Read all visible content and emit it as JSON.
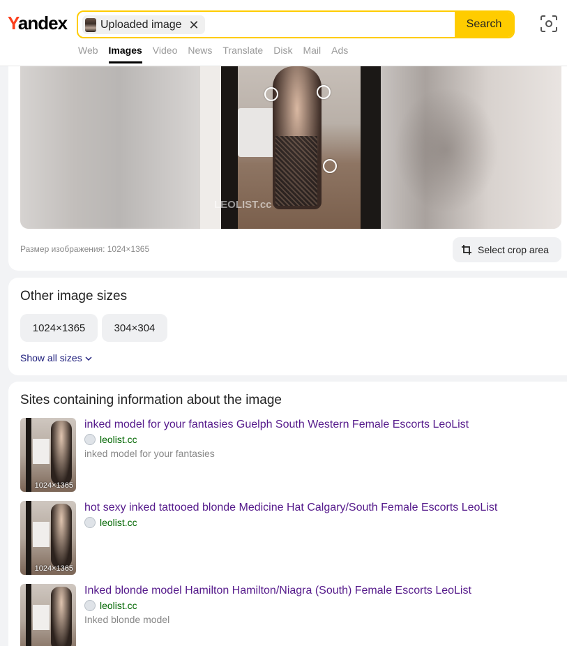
{
  "logo": {
    "first": "Y",
    "rest": "andex"
  },
  "search": {
    "chip_label": "Uploaded image",
    "chip_close": "✕",
    "button_label": "Search"
  },
  "tabs": [
    {
      "label": "Web",
      "active": false
    },
    {
      "label": "Images",
      "active": true
    },
    {
      "label": "Video",
      "active": false
    },
    {
      "label": "News",
      "active": false
    },
    {
      "label": "Translate",
      "active": false
    },
    {
      "label": "Disk",
      "active": false
    },
    {
      "label": "Mail",
      "active": false
    },
    {
      "label": "Ads",
      "active": false
    }
  ],
  "viewer": {
    "watermark": "LEOLIST.cc",
    "size_label": "Размер изображения: 1024×1365",
    "crop_label": "Select crop area"
  },
  "other_sizes": {
    "title": "Other image sizes",
    "sizes": [
      "1024×1365",
      "304×304"
    ],
    "show_all": "Show all sizes"
  },
  "sites": {
    "title": "Sites containing information about the image",
    "results": [
      {
        "title": "inked model for your fantasies Guelph South Western Female Escorts LeoList",
        "site": "leolist.cc",
        "desc": "inked model for your fantasies",
        "badge": "1024×1365"
      },
      {
        "title": "hot sexy inked tattooed blonde Medicine Hat Calgary/South Female Escorts LeoList",
        "site": "leolist.cc",
        "desc": "",
        "badge": "1024×1365"
      },
      {
        "title": "Inked blonde model Hamilton Hamilton/Niagra (South) Female Escorts LeoList",
        "site": "leolist.cc",
        "desc": "Inked blonde model",
        "badge": ""
      }
    ]
  },
  "colors": {
    "accent": "#ffcc00",
    "logo_y": "#fc3f1d",
    "link_visited": "#551a8b",
    "site_green": "#006600"
  }
}
